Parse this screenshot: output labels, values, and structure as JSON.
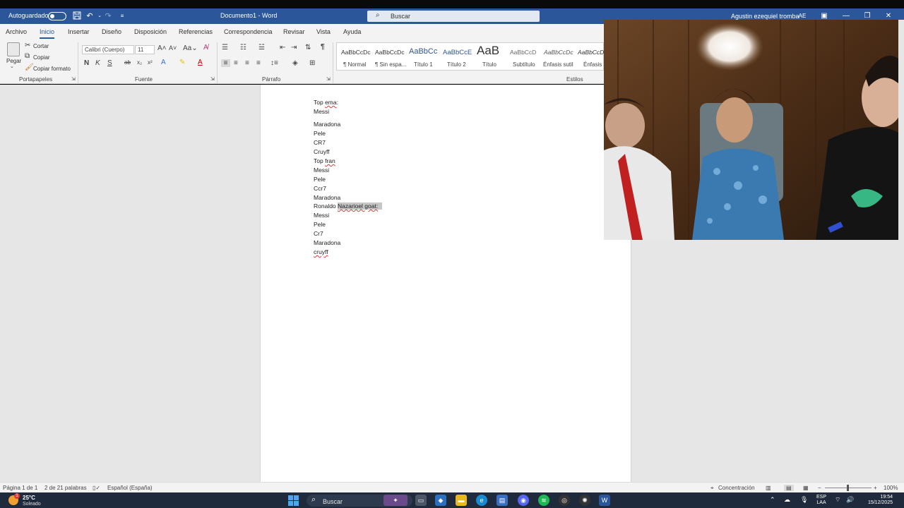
{
  "window": {
    "autosave_label": "Autoguardado",
    "doc_title": "Documento1 - Word",
    "search_placeholder": "Buscar",
    "user_name": "Agustin ezequiel tromba",
    "user_initials": "AE"
  },
  "tabs": [
    "Archivo",
    "Inicio",
    "Insertar",
    "Diseño",
    "Disposición",
    "Referencias",
    "Correspondencia",
    "Revisar",
    "Vista",
    "Ayuda"
  ],
  "ribbon": {
    "clipboard": {
      "paste": "Pegar",
      "cut": "Cortar",
      "copy": "Copiar",
      "format_painter": "Copiar formato",
      "label": "Portapapeles"
    },
    "font": {
      "name": "Calibri (Cuerpo)",
      "size": "11",
      "label": "Fuente",
      "bold": "N",
      "italic": "K",
      "underline": "S"
    },
    "paragraph": {
      "label": "Párrafo"
    },
    "styles": {
      "label": "Estilos",
      "items": [
        {
          "sample": "AaBbCcDc",
          "name": "¶ Normal"
        },
        {
          "sample": "AaBbCcDc",
          "name": "¶ Sin espa..."
        },
        {
          "sample": "AaBbCc",
          "name": "Título 1"
        },
        {
          "sample": "AaBbCcE",
          "name": "Título 2"
        },
        {
          "sample": "AaB",
          "name": "Título"
        },
        {
          "sample": "AaBbCcD",
          "name": "Subtítulo"
        },
        {
          "sample": "AaBbCcDc",
          "name": "Énfasis sutil"
        },
        {
          "sample": "AaBbCcDc",
          "name": "Énfasis"
        }
      ]
    }
  },
  "document": {
    "lines": [
      {
        "text": "Top ",
        "spell": "ema",
        "after": ":"
      },
      {
        "text": "Messi"
      },
      {
        "text": "Maradona"
      },
      {
        "text": "Pele"
      },
      {
        "text": "CR7"
      },
      {
        "text": "Cruyff"
      },
      {
        "text": "Top ",
        "spell": "fran",
        "after": ""
      },
      {
        "text": "Messi"
      },
      {
        "text": "Pele"
      },
      {
        "text": "Ccr7"
      },
      {
        "text": "Maradona"
      },
      {
        "text": "Ronaldo ",
        "selected": "Nazarioel goat:"
      },
      {
        "text": "Messi"
      },
      {
        "text": "Pele"
      },
      {
        "text": "Cr7"
      },
      {
        "text": "Maradona"
      },
      {
        "text": "",
        "spell": "cruyff",
        "after": ""
      }
    ]
  },
  "statusbar": {
    "page": "Página 1 de 1",
    "words": "2 de 21 palabras",
    "language": "Español (España)",
    "focus": "Concentración",
    "zoom": "100%"
  },
  "taskbar": {
    "temperature": "25°C",
    "condition": "Soleado",
    "weather_badge": "1",
    "search_text": "Buscar",
    "lang_primary": "ESP",
    "lang_secondary": "LAA",
    "time": "19:54",
    "date": "15/12/2025"
  }
}
